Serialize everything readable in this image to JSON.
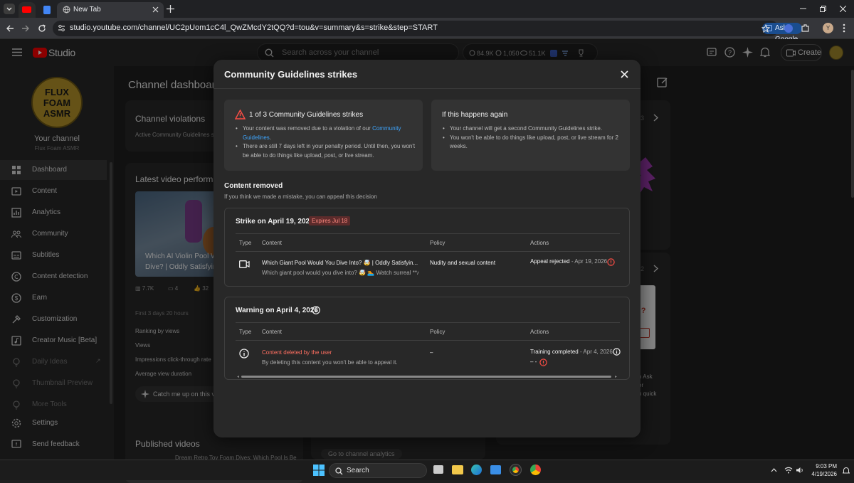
{
  "browser": {
    "tab_active_title": "New Tab",
    "url": "studio.youtube.com/channel/UC2pUom1cC4l_QwZMcdY2tQQ?d=tou&v=summary&s=strike&step=START",
    "ask_google": "Ask Google",
    "profile_initial": "Y"
  },
  "studio": {
    "logo_text": "Studio",
    "search_placeholder": "Search across your channel",
    "stats": [
      "84.9K",
      "1,050",
      "51.1K"
    ],
    "create_label": "Create"
  },
  "sidebar": {
    "avatar_text": "FLUX FOAM ASMR",
    "your_channel": "Your channel",
    "channel_name": "Flux Foam ASMR",
    "items": [
      {
        "label": "Dashboard",
        "icon": "dashboard-icon"
      },
      {
        "label": "Content",
        "icon": "content-icon"
      },
      {
        "label": "Analytics",
        "icon": "analytics-icon"
      },
      {
        "label": "Community",
        "icon": "community-icon"
      },
      {
        "label": "Subtitles",
        "icon": "subtitles-icon"
      },
      {
        "label": "Content detection",
        "icon": "copyright-icon"
      },
      {
        "label": "Earn",
        "icon": "dollar-icon"
      },
      {
        "label": "Customization",
        "icon": "customization-icon"
      },
      {
        "label": "Creator Music [Beta]",
        "icon": "music-icon"
      },
      {
        "label": "Daily Ideas",
        "icon": "bulb-icon"
      },
      {
        "label": "Thumbnail Preview",
        "icon": "bulb-icon"
      },
      {
        "label": "More Tools",
        "icon": "bulb-icon"
      }
    ],
    "settings": "Settings",
    "feedback": "Send feedback"
  },
  "dashboard": {
    "title": "Channel dashboar",
    "violations_title": "Channel violations",
    "violations_sub": "Active Community Guidelines s",
    "latest_title": "Latest video performa",
    "video_overlay": [
      "Which AI Violin Pool W",
      "Dive? | Oddly Satisfyin"
    ],
    "video_stats": [
      "7.7K",
      "4",
      "32"
    ],
    "first_days": "First 3 days 20 hours",
    "rows": [
      "Ranking by views",
      "Views",
      "Impressions click-through rate",
      "Average view duration"
    ],
    "catch_me": "Catch me up on this v",
    "published_title": "Published videos",
    "published_item": "Dream Retro Toy Foam Dives: Which Pool Is Be",
    "go_analytics": "Go to channel analytics",
    "pager1": "/ 3",
    "pager2": "/ 2",
    "right_snips": [
      "h Ask",
      "or",
      "u quick"
    ],
    "thumb_q": "u?"
  },
  "modal": {
    "title": "Community Guidelines strikes",
    "left_box": {
      "title": "1 of 3 Community Guidelines strikes",
      "b1_pre": "Your content was removed due to a violation of our",
      "b1_link": "Community Guidelines",
      "b1_post": ".",
      "b2": "There are still 7 days left in your penalty period. Until then, you won't be able to do things like upload, post, or live stream."
    },
    "right_box": {
      "title": "If this happens again",
      "b1": "Your channel will get a second Community Guidelines strike.",
      "b2": "You won't be able to do things like upload, post, or live stream for 2 weeks."
    },
    "removed_title": "Content removed",
    "removed_sub": "If you think we made a mistake, you can appeal this decision",
    "headers": {
      "type": "Type",
      "content": "Content",
      "policy": "Policy",
      "actions": "Actions"
    },
    "strike": {
      "title": "Strike on April 19, 2026",
      "badge": "Expires Jul 18",
      "video_title": "Which Giant Pool Would You Dive Into? 🤯 | Oddly Satisfyin...",
      "video_desc": "Which giant pool would you dive into? 🤯 🏊 Watch surreal **A...",
      "policy": "Nudity and sexual content",
      "action": "Appeal rejected",
      "action_date": "- Apr 19, 2026"
    },
    "warning": {
      "title": "Warning on April 4, 2026",
      "content_title": "Content deleted by the user",
      "content_desc": "By deleting this content you won't be able to appeal it.",
      "policy": "–",
      "action": "Training completed",
      "action_date": "- Apr 4, 2026",
      "action2": "– -"
    }
  },
  "taskbar": {
    "search": "Search",
    "time": "9:03 PM",
    "date": "4/19/2026"
  },
  "colors": {
    "link": "#3ea6ff",
    "red": "#ff4e45",
    "badge_bg": "#5c2b2b",
    "badge_fg": "#ff8a80"
  }
}
